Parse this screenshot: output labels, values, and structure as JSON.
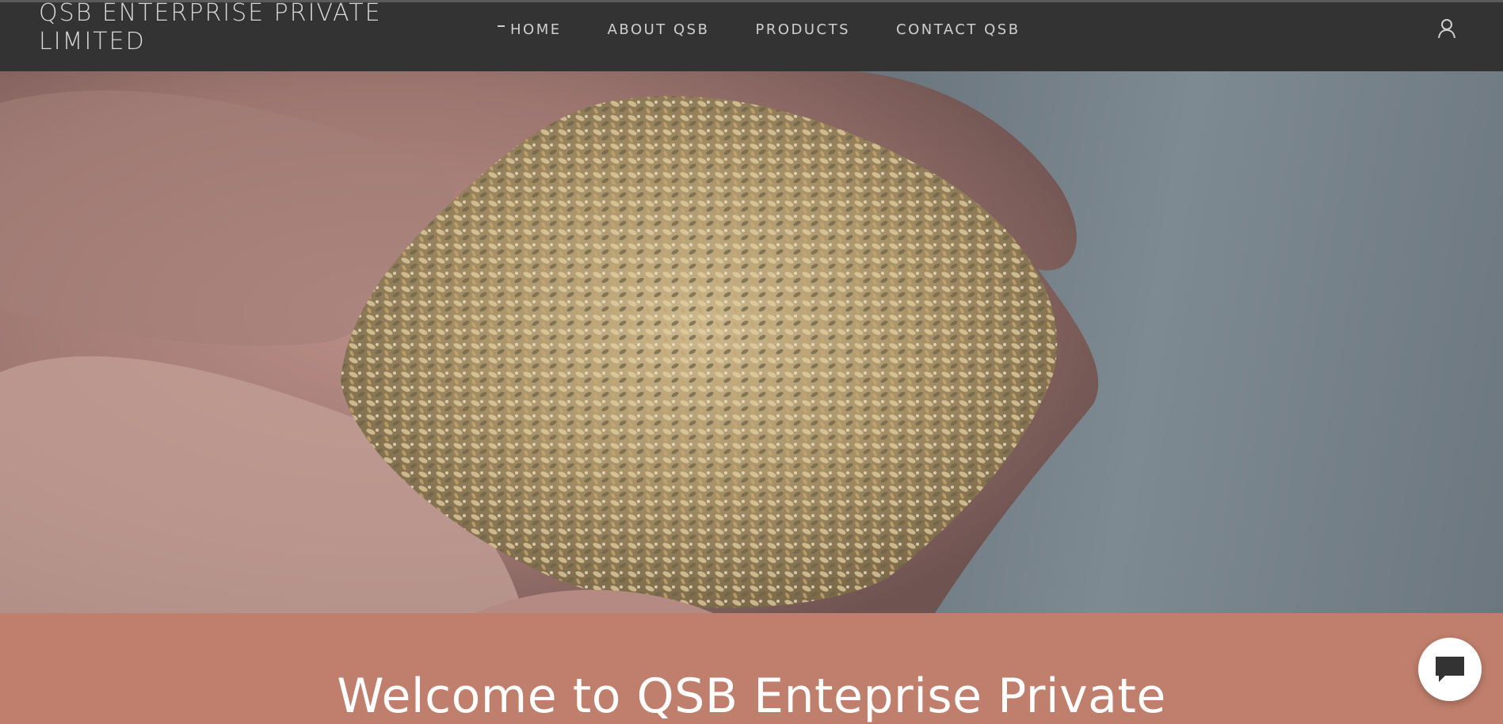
{
  "header": {
    "brand": "QSB ENTERPRISE PRIVATE LIMITED",
    "nav": [
      {
        "label": "HOME",
        "active": true
      },
      {
        "label": "ABOUT QSB",
        "active": false
      },
      {
        "label": "PRODUCTS",
        "active": false
      },
      {
        "label": "CONTACT QSB",
        "active": false
      }
    ],
    "account_icon": "user-icon"
  },
  "hero": {
    "image": "hands-holding-animal-feed-grain-mix"
  },
  "welcome": {
    "heading": "Welcome to QSB Enteprise Private"
  },
  "chat": {
    "icon": "chat-bubble-icon"
  },
  "colors": {
    "header_bg": "#333333",
    "nav_text": "#cfcfcf",
    "welcome_bg": "#c07f6c",
    "heading_text": "#ffffff"
  }
}
